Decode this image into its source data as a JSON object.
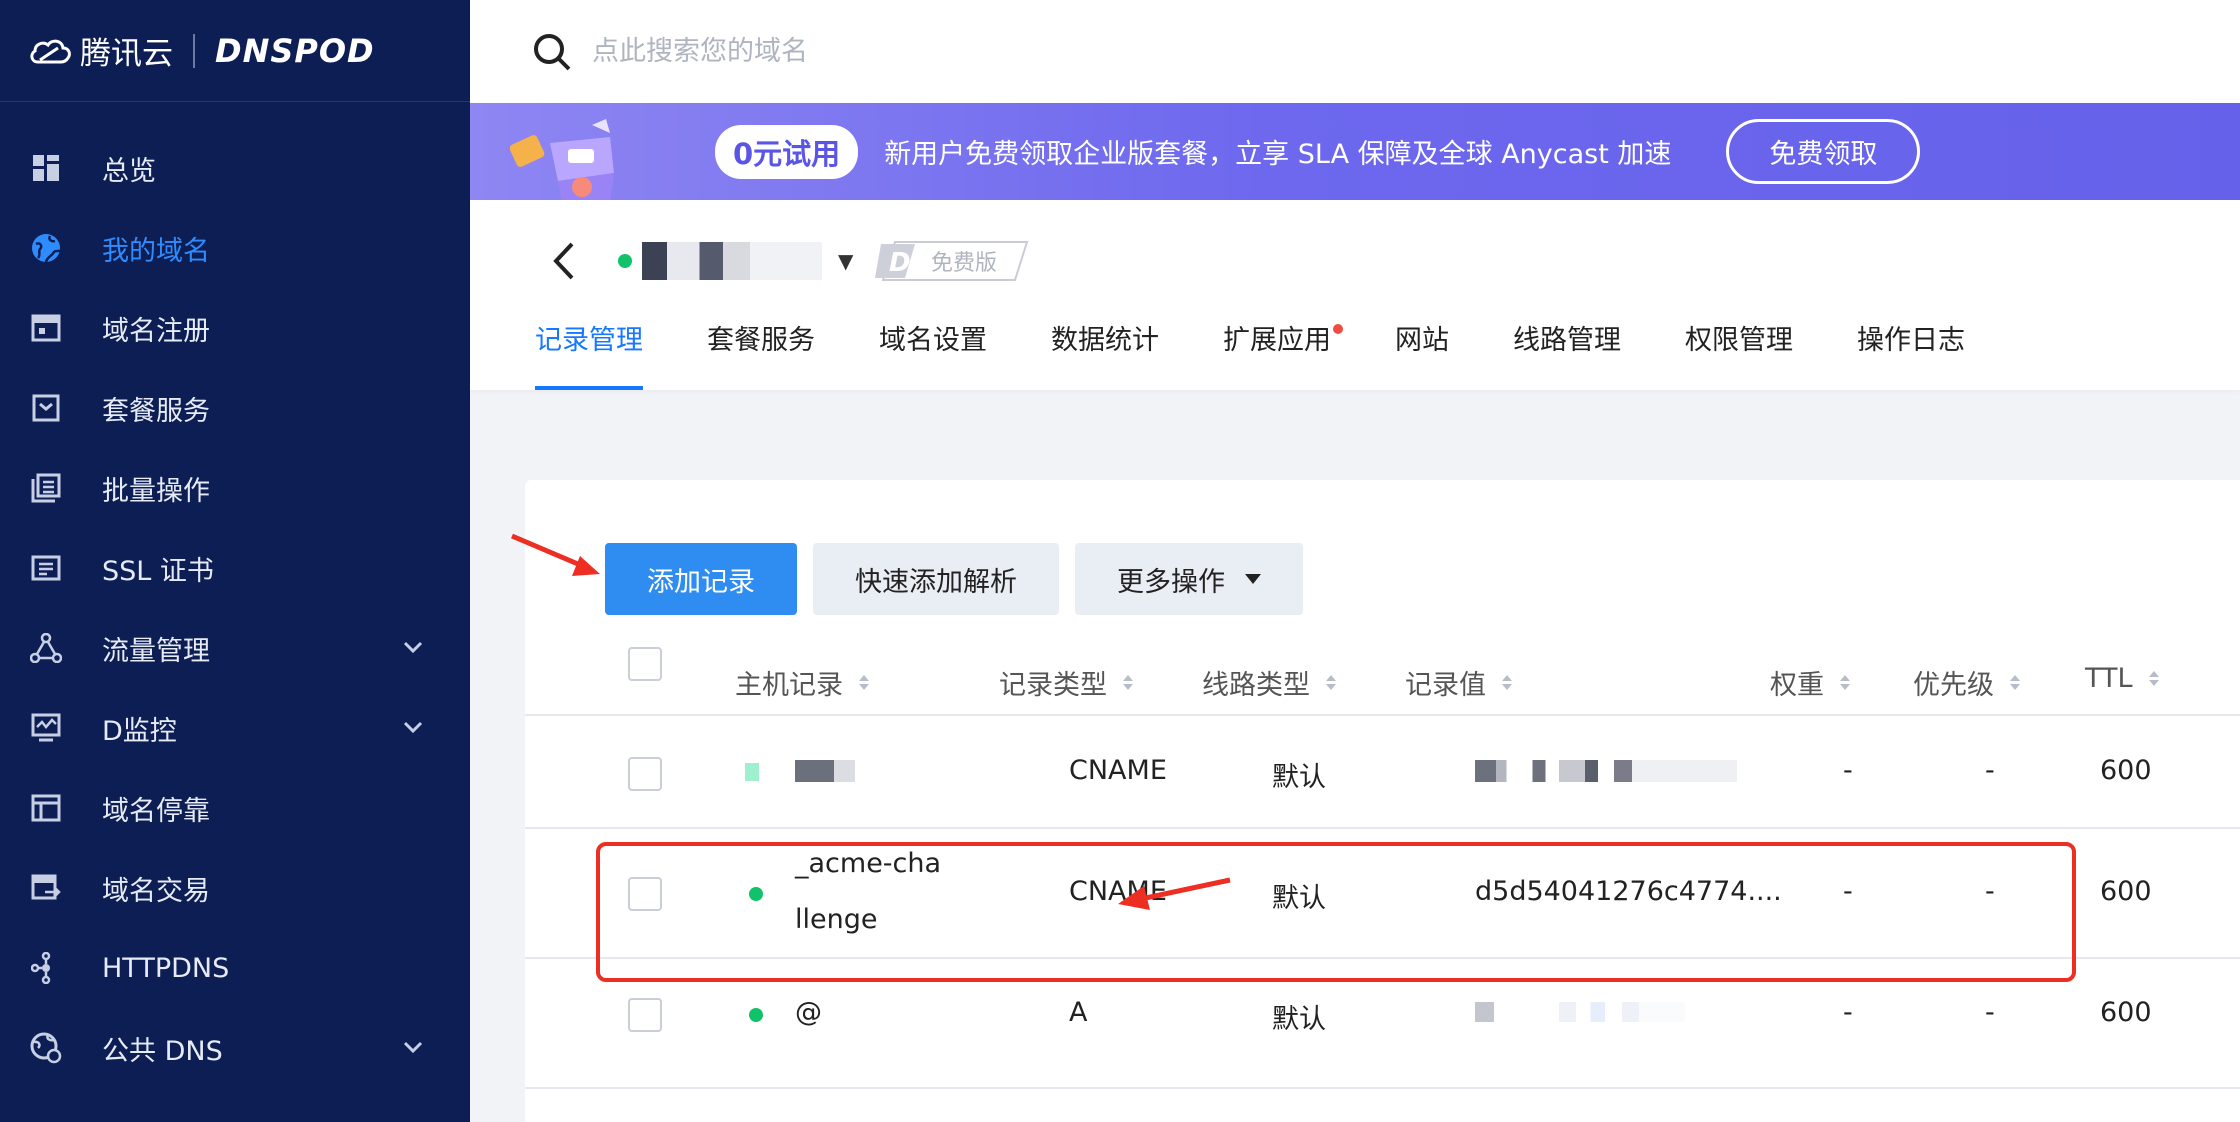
{
  "brand": {
    "tencent": "腾讯云",
    "dnspod": "DNSPOD"
  },
  "sidebar": {
    "items": [
      {
        "label": "总览",
        "icon": "dashboard-icon"
      },
      {
        "label": "我的域名",
        "icon": "globe-icon",
        "active": true
      },
      {
        "label": "域名注册",
        "icon": "register-icon"
      },
      {
        "label": "套餐服务",
        "icon": "package-icon"
      },
      {
        "label": "批量操作",
        "icon": "batch-icon"
      },
      {
        "label": "SSL 证书",
        "icon": "certificate-icon"
      },
      {
        "label": "流量管理",
        "icon": "traffic-icon",
        "expandable": true
      },
      {
        "label": "D监控",
        "icon": "monitor-icon",
        "expandable": true
      },
      {
        "label": "域名停靠",
        "icon": "parking-icon"
      },
      {
        "label": "域名交易",
        "icon": "trade-icon"
      },
      {
        "label": "HTTPDNS",
        "icon": "httpdns-icon"
      },
      {
        "label": "公共 DNS",
        "icon": "public-dns-icon",
        "expandable": true
      }
    ]
  },
  "search": {
    "placeholder": "点此搜索您的域名"
  },
  "banner": {
    "pill": "0元试用",
    "text": "新用户免费领取企业版套餐，立享 SLA 保障及全球 Anycast 加速",
    "button": "免费领取"
  },
  "domain": {
    "status_color": "#10c26a",
    "plan_badge": "免费版"
  },
  "tabs": [
    {
      "label": "记录管理",
      "active": true
    },
    {
      "label": "套餐服务"
    },
    {
      "label": "域名设置"
    },
    {
      "label": "数据统计"
    },
    {
      "label": "扩展应用",
      "dot": true
    },
    {
      "label": "网站"
    },
    {
      "label": "线路管理"
    },
    {
      "label": "权限管理"
    },
    {
      "label": "操作日志"
    }
  ],
  "toolbar": {
    "add": "添加记录",
    "quick_add": "快速添加解析",
    "more": "更多操作"
  },
  "table": {
    "headers": [
      "主机记录",
      "记录类型",
      "线路类型",
      "记录值",
      "权重",
      "优先级",
      "TTL"
    ],
    "rows": [
      {
        "host": "",
        "type": "CNAME",
        "line": "默认",
        "value": "",
        "weight": "-",
        "priority": "-",
        "ttl": "600"
      },
      {
        "host_line1": "_acme-cha",
        "host_line2": "llenge",
        "type": "CNAME",
        "line": "默认",
        "value": "d5d54041276c4774....",
        "weight": "-",
        "priority": "-",
        "ttl": "600"
      },
      {
        "host": "@",
        "type": "A",
        "line": "默认",
        "value": "",
        "weight": "-",
        "priority": "-",
        "ttl": "600"
      }
    ]
  },
  "colors": {
    "sidebar_bg": "#0c1e54",
    "accent": "#1677ff",
    "highlight": "#ec2e23",
    "banner": "#6d68ee"
  }
}
